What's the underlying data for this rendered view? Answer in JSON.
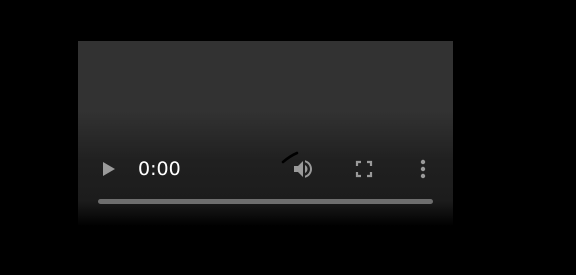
{
  "player": {
    "current_time": "0:00",
    "progress": 0,
    "icons": {
      "play": "play-icon",
      "volume": "volume-icon",
      "fullscreen": "fullscreen-icon",
      "more": "more-vertical-icon",
      "loading": "loading-spinner-icon"
    },
    "colors": {
      "background": "#000000",
      "player_top": "#323232",
      "controls_icon": "#9a9a9a",
      "timeline_track": "#6e6e6e",
      "text": "#ffffff"
    }
  }
}
